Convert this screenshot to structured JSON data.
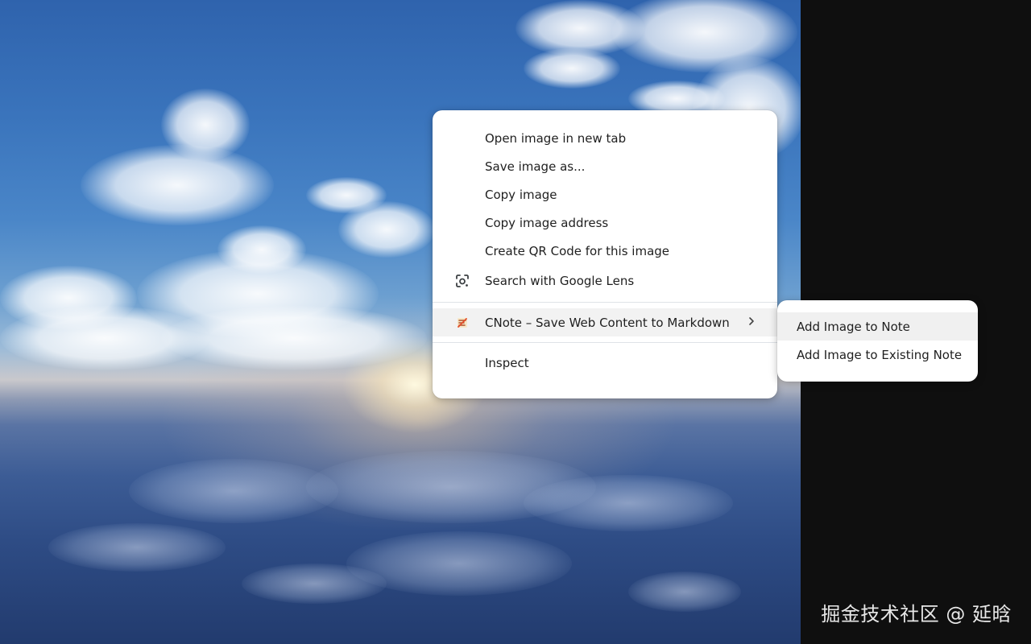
{
  "context_menu": {
    "items": [
      {
        "label": "Open image in new tab"
      },
      {
        "label": "Save image as..."
      },
      {
        "label": "Copy image"
      },
      {
        "label": "Copy image address"
      },
      {
        "label": "Create QR Code for this image"
      },
      {
        "label": "Search with Google Lens",
        "icon": "google-lens-icon"
      }
    ],
    "extension_item": {
      "label": "CNote – Save Web Content to Markdown",
      "icon": "cnote-icon"
    },
    "inspect_label": "Inspect"
  },
  "submenu": {
    "items": [
      {
        "label": "Add Image to Note"
      },
      {
        "label": "Add Image to Existing Note"
      }
    ]
  },
  "watermark": "掘金技术社区 @ 延晗",
  "colors": {
    "menu_bg": "#ffffff",
    "menu_text": "#1f1f1f",
    "highlight": "#f2f2f2",
    "page_bg": "#0f0f0f"
  }
}
